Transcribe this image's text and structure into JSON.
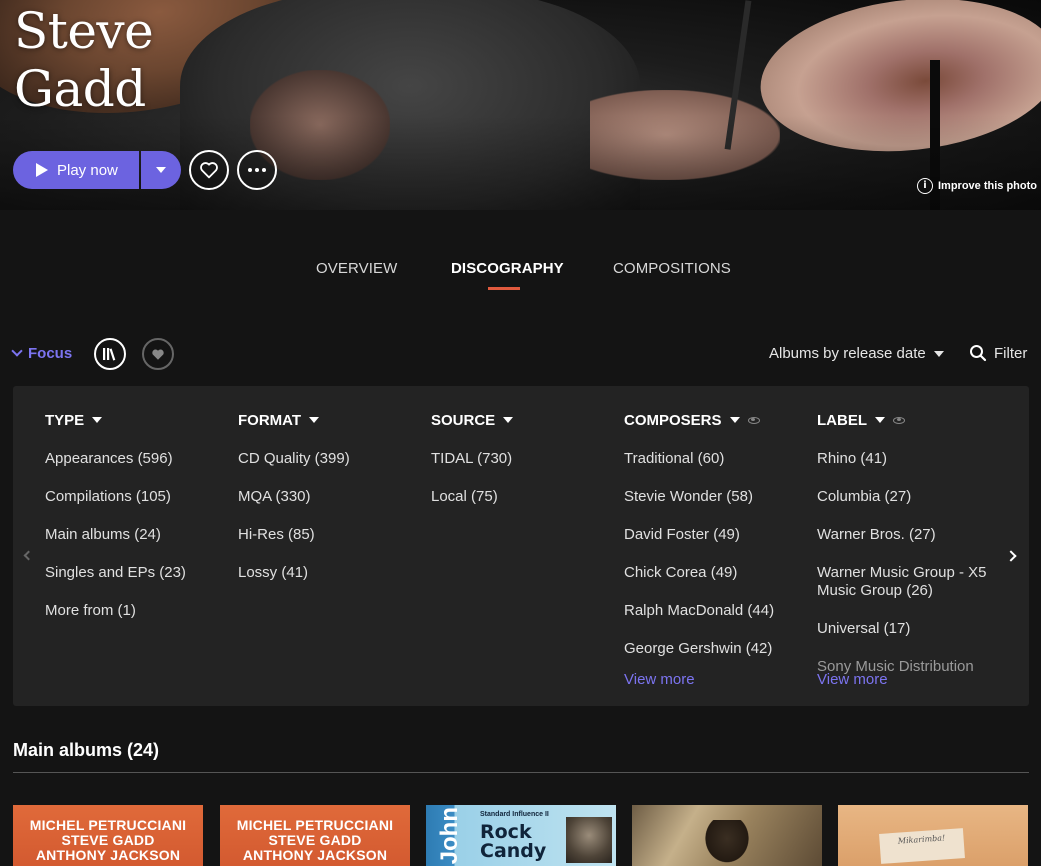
{
  "artist": {
    "first_name": "Steve",
    "last_name": "Gadd"
  },
  "hero": {
    "play_label": "Play now",
    "improve_label": "Improve this photo",
    "info_glyph": "i"
  },
  "tabs": [
    {
      "label": "OVERVIEW",
      "active": false
    },
    {
      "label": "DISCOGRAPHY",
      "active": true
    },
    {
      "label": "COMPOSITIONS",
      "active": false
    }
  ],
  "toolbar": {
    "focus_label": "Focus",
    "sort_label": "Albums by release date",
    "filter_label": "Filter"
  },
  "filters": {
    "type": {
      "title": "TYPE",
      "items": [
        "Appearances (596)",
        "Compilations (105)",
        "Main albums (24)",
        "Singles and EPs (23)",
        "More from (1)"
      ]
    },
    "format": {
      "title": "FORMAT",
      "items": [
        "CD Quality (399)",
        "MQA (330)",
        "Hi-Res (85)",
        "Lossy (41)"
      ]
    },
    "source": {
      "title": "SOURCE",
      "items": [
        "TIDAL (730)",
        "Local (75)"
      ]
    },
    "composers": {
      "title": "COMPOSERS",
      "items": [
        "Traditional (60)",
        "Stevie Wonder (58)",
        "David Foster (49)",
        "Chick Corea (49)",
        "Ralph MacDonald (44)",
        "George Gershwin (42)"
      ],
      "view_more": "View more"
    },
    "label": {
      "title": "LABEL",
      "items": [
        "Rhino (41)",
        "Columbia (27)",
        "Warner Bros. (27)",
        "Warner Music Group - X5 Music Group (26)",
        "Universal (17)",
        "Sony Music Distribution"
      ],
      "view_more": "View more"
    }
  },
  "main_albums": {
    "title": "Main albums (24)",
    "albums": [
      {
        "cover_lines": [
          "MICHEL PETRUCCIANI",
          "STEVE GADD",
          "ANTHONY JACKSON"
        ]
      },
      {
        "cover_lines": [
          "MICHEL PETRUCCIANI",
          "STEVE GADD",
          "ANTHONY JACKSON"
        ]
      },
      {
        "cover_vertical": "John",
        "cover_small": "Standard Influence II",
        "cover_title_1": "Rock",
        "cover_title_2": "Candy"
      },
      {},
      {
        "cover_tag": "Mikarimba!"
      }
    ]
  },
  "colors": {
    "accent": "#6c63e0",
    "link": "#7c74f0",
    "tab_underline": "#e05a3e",
    "panel_bg": "#232323",
    "page_bg": "#141414"
  },
  "icons": {
    "play": "play-icon",
    "favorite": "heart-icon",
    "more": "more-icon",
    "library": "library-icon",
    "search": "search-icon"
  }
}
